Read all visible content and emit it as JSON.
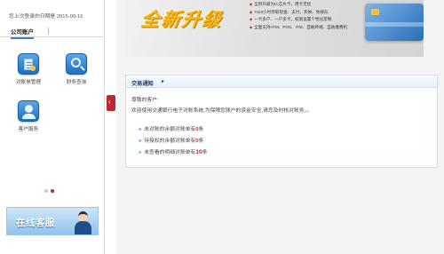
{
  "sidebar": {
    "last_login_label": "您上次登录的日期是",
    "last_login_date": "2015-09-16",
    "tab_label": "公司账户",
    "tiles": [
      {
        "label": "对账单管理",
        "icon": "reconciliation-doc-icon"
      },
      {
        "label": "财务查询",
        "icon": "finance-search-icon"
      },
      {
        "label": "客户服务",
        "icon": "customer-service-icon"
      }
    ],
    "pager": {
      "count": 2,
      "active": 2
    },
    "cs_banner_text": "在线客服"
  },
  "collapse_handle": {
    "glyph": "‹",
    "icon": "collapse-left-icon"
  },
  "banner": {
    "title": "全新升级",
    "bullets": [
      "全新升级为IC芯片卡，用卡无忧",
      "7x24小时存取现金、支付、买换、免排队",
      "一卡多户、一户多卡，权限设置个性化定制",
      "全面支持ATM、POS、ITM、自助终端、自助缴费机"
    ]
  },
  "notice": {
    "title": "交易通知",
    "greeting": "尊敬的客户:",
    "welcome": "欢迎使用交通银行电子对账系统,为保障您账户的资金安全,请您及时核对账务。。",
    "items": [
      {
        "prefix": "未对账的余额对账单有",
        "count": "0",
        "suffix": "条"
      },
      {
        "prefix": "待授权的余额对账单有",
        "count": "0",
        "suffix": "条"
      },
      {
        "prefix": "未查看的明细对账单有",
        "count": "10",
        "suffix": "条"
      }
    ]
  },
  "colors": {
    "accent_red": "#c0282d",
    "accent_blue": "#1f5fa8",
    "banner_gold": "#f3b81d"
  }
}
